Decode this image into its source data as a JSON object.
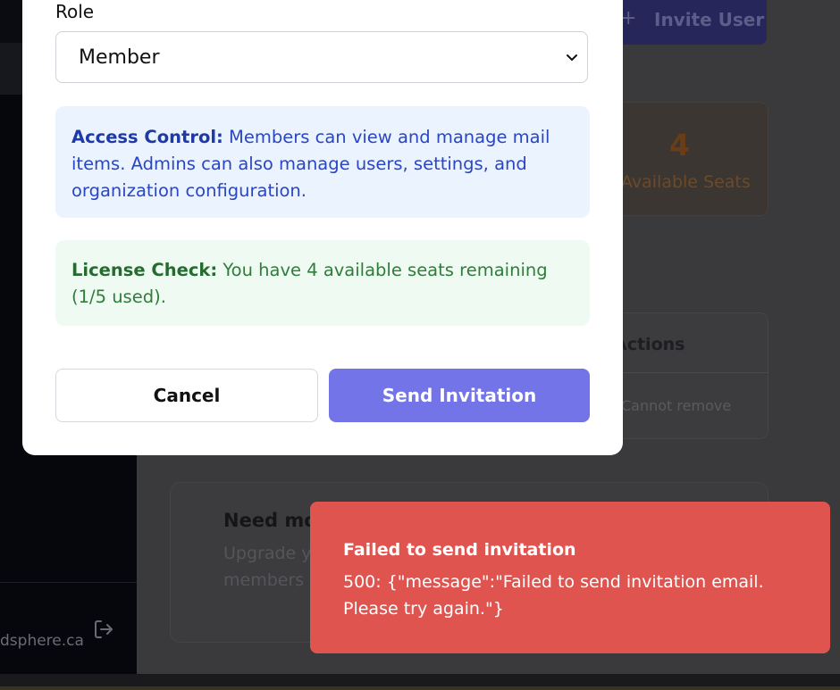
{
  "background": {
    "header": {
      "invite_button_icon": "+",
      "invite_button_label": "Invite User"
    },
    "stats": {
      "available_seats_value": "4",
      "available_seats_label": "Available Seats"
    },
    "members_table": {
      "actions_header": "Actions",
      "row_action_text": "Cannot remove"
    },
    "upgrade_card": {
      "title": "Need mo",
      "body": "Upgrade y members"
    },
    "sidebar": {
      "footer_domain": "dsphere.ca",
      "logout_icon": "logout-icon"
    }
  },
  "modal": {
    "role_label": "Role",
    "role_select": {
      "selected": "Member"
    },
    "access_control": {
      "label": "Access Control:",
      "text": " Members can view and manage mail items. Admins can also manage users, settings, and organization configuration."
    },
    "license_check": {
      "label": "License Check:",
      "text": " You have 4 available seats remaining (1/5 used)."
    },
    "cancel_label": "Cancel",
    "send_label": "Send Invitation"
  },
  "toast": {
    "title": "Failed to send invitation",
    "message": "500: {\"message\":\"Failed to send invitation email. Please try again.\"}"
  },
  "colors": {
    "primary_button": "#7474e9",
    "toast_error": "#e05450",
    "info_bg": "#ebf3ff",
    "success_bg": "#effbf2"
  }
}
